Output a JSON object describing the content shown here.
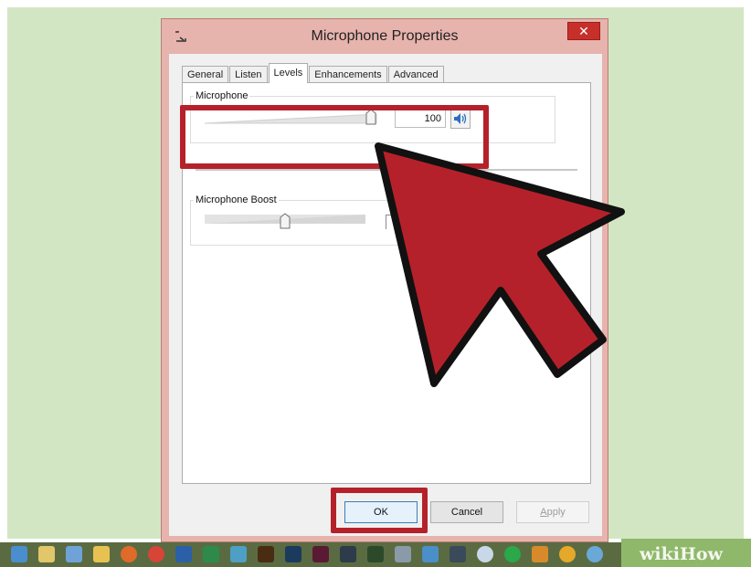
{
  "window": {
    "title": "Microphone Properties",
    "close_glyph": "✕"
  },
  "tabs": [
    {
      "label": "General",
      "active": false
    },
    {
      "label": "Listen",
      "active": false
    },
    {
      "label": "Levels",
      "active": true
    },
    {
      "label": "Enhancements",
      "active": false
    },
    {
      "label": "Advanced",
      "active": false
    }
  ],
  "levels": {
    "microphone_label": "Microphone",
    "microphone_value": "100",
    "microphone_level_fraction": 1.0,
    "boost_label": "Microphone Boost",
    "boost_level_fraction": 0.33
  },
  "buttons": {
    "ok": "OK",
    "cancel": "Cancel",
    "apply": "Apply"
  },
  "icons": {
    "title": "microphone-icon",
    "speaker": "speaker-icon",
    "pointer": "red-arrow-icon"
  },
  "colors": {
    "highlight": "#b5212a",
    "desktop": "#d3e6c4",
    "window_frame": "#e7b3ad",
    "close_button": "#c7302a"
  },
  "watermark": {
    "wiki": "wiki",
    "how": "How"
  }
}
